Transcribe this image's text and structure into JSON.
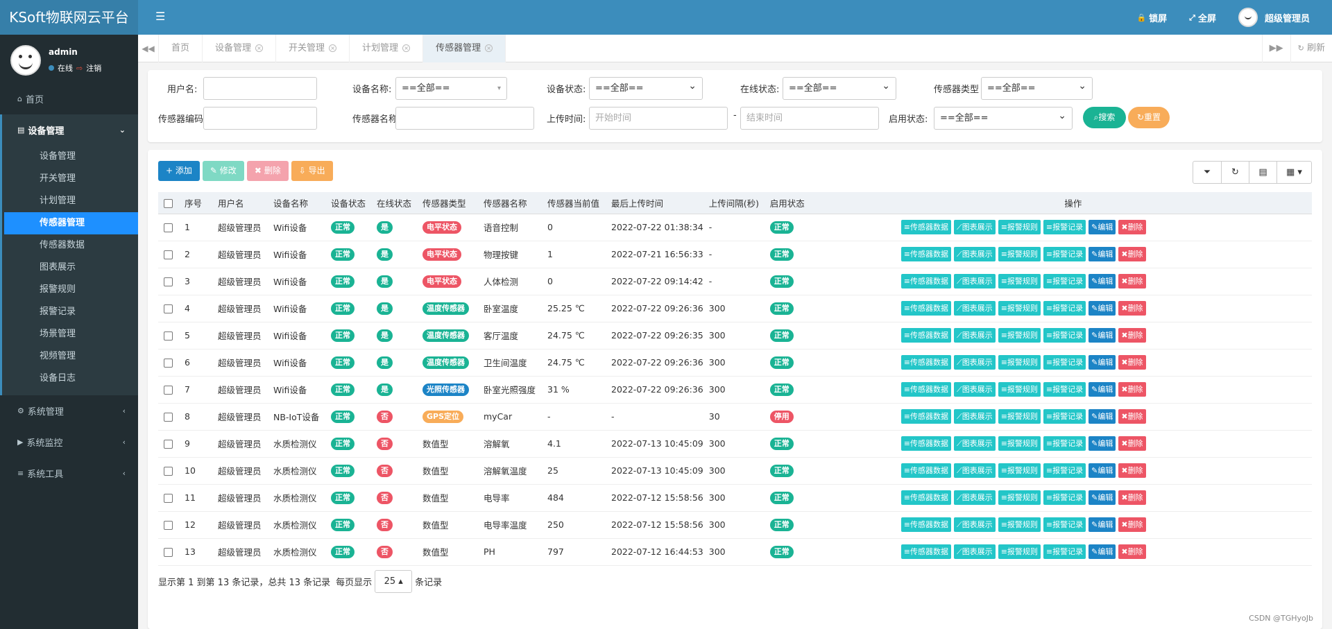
{
  "app": {
    "title": "KSoft物联网云平台"
  },
  "topbar": {
    "lock_label": "锁屏",
    "fullscreen_label": "全屏",
    "user_label": "超级管理员"
  },
  "user": {
    "name": "admin",
    "status": "在线",
    "logout": "注销"
  },
  "sidebar": {
    "home": "首页",
    "device_group": "设备管理",
    "device_items": [
      "设备管理",
      "开关管理",
      "计划管理",
      "传感器管理",
      "传感器数据",
      "图表展示",
      "报警规则",
      "报警记录",
      "场景管理",
      "视频管理",
      "设备日志"
    ],
    "active_item": "传感器管理",
    "system_manage": "系统管理",
    "system_monitor": "系统监控",
    "system_tools": "系统工具"
  },
  "tabs": [
    {
      "label": "首页",
      "closable": false
    },
    {
      "label": "设备管理",
      "closable": true
    },
    {
      "label": "开关管理",
      "closable": true
    },
    {
      "label": "计划管理",
      "closable": true
    },
    {
      "label": "传感器管理",
      "closable": true,
      "active": true
    }
  ],
  "tabs_refresh": "刷新",
  "search": {
    "username_label": "用户名:",
    "device_name_label": "设备名称:",
    "device_name_value": "==全部==",
    "device_status_label": "设备状态:",
    "device_status_value": "==全部==",
    "online_status_label": "在线状态:",
    "online_status_value": "==全部==",
    "sensor_type_label": "传感器类型",
    "sensor_type_value": "==全部==",
    "sensor_code_label": "传感器编码",
    "sensor_name_label": "传感器名称",
    "upload_time_label": "上传时间:",
    "start_placeholder": "开始时间",
    "dash": "-",
    "end_placeholder": "结束时间",
    "enable_status_label": "启用状态:",
    "enable_status_value": "==全部==",
    "search_btn": "搜索",
    "reset_btn": "重置"
  },
  "toolbar": {
    "add": "添加",
    "edit": "修改",
    "delete": "删除",
    "export": "导出"
  },
  "columns": [
    "序号",
    "用户名",
    "设备名称",
    "设备状态",
    "在线状态",
    "传感器类型",
    "传感器名称",
    "传感器当前值",
    "最后上传时间",
    "上传间隔(秒)",
    "启用状态",
    "操作"
  ],
  "row_actions": {
    "data": "传感器数据",
    "chart": "图表展示",
    "rule": "报警规则",
    "record": "报警记录",
    "edit": "编辑",
    "delete": "删除"
  },
  "rows": [
    {
      "no": "1",
      "user": "超级管理员",
      "device": "Wifi设备",
      "dstatus": "正常",
      "online": "是",
      "stype": "电平状态",
      "stype_style": "level",
      "sname": "语音控制",
      "value": "0",
      "time": "2022-07-22 01:38:34",
      "interval": "-",
      "enable": "正常"
    },
    {
      "no": "2",
      "user": "超级管理员",
      "device": "Wifi设备",
      "dstatus": "正常",
      "online": "是",
      "stype": "电平状态",
      "stype_style": "level",
      "sname": "物理按键",
      "value": "1",
      "time": "2022-07-21 16:56:33",
      "interval": "-",
      "enable": "正常"
    },
    {
      "no": "3",
      "user": "超级管理员",
      "device": "Wifi设备",
      "dstatus": "正常",
      "online": "是",
      "stype": "电平状态",
      "stype_style": "level",
      "sname": "人体检测",
      "value": "0",
      "time": "2022-07-22 09:14:42",
      "interval": "-",
      "enable": "正常"
    },
    {
      "no": "4",
      "user": "超级管理员",
      "device": "Wifi设备",
      "dstatus": "正常",
      "online": "是",
      "stype": "温度传感器",
      "stype_style": "temp",
      "sname": "卧室温度",
      "value": "25.25 ℃",
      "time": "2022-07-22 09:26:36",
      "interval": "300",
      "enable": "正常"
    },
    {
      "no": "5",
      "user": "超级管理员",
      "device": "Wifi设备",
      "dstatus": "正常",
      "online": "是",
      "stype": "温度传感器",
      "stype_style": "temp",
      "sname": "客厅温度",
      "value": "24.75 ℃",
      "time": "2022-07-22 09:26:35",
      "interval": "300",
      "enable": "正常"
    },
    {
      "no": "6",
      "user": "超级管理员",
      "device": "Wifi设备",
      "dstatus": "正常",
      "online": "是",
      "stype": "温度传感器",
      "stype_style": "temp",
      "sname": "卫生间温度",
      "value": "24.75 ℃",
      "time": "2022-07-22 09:26:36",
      "interval": "300",
      "enable": "正常"
    },
    {
      "no": "7",
      "user": "超级管理员",
      "device": "Wifi设备",
      "dstatus": "正常",
      "online": "是",
      "stype": "光照传感器",
      "stype_style": "light",
      "sname": "卧室光照强度",
      "value": "31 %",
      "time": "2022-07-22 09:26:36",
      "interval": "300",
      "enable": "正常"
    },
    {
      "no": "8",
      "user": "超级管理员",
      "device": "NB-IoT设备",
      "dstatus": "正常",
      "online": "否",
      "stype": "GPS定位",
      "stype_style": "gps",
      "sname": "myCar",
      "value": "-",
      "time": "-",
      "interval": "30",
      "enable": "停用"
    },
    {
      "no": "9",
      "user": "超级管理员",
      "device": "水质检测仪",
      "dstatus": "正常",
      "online": "否",
      "stype": "数值型",
      "stype_style": "plain",
      "sname": "溶解氧",
      "value": "4.1",
      "time": "2022-07-13 10:45:09",
      "interval": "300",
      "enable": "正常"
    },
    {
      "no": "10",
      "user": "超级管理员",
      "device": "水质检测仪",
      "dstatus": "正常",
      "online": "否",
      "stype": "数值型",
      "stype_style": "plain",
      "sname": "溶解氧温度",
      "value": "25",
      "time": "2022-07-13 10:45:09",
      "interval": "300",
      "enable": "正常"
    },
    {
      "no": "11",
      "user": "超级管理员",
      "device": "水质检测仪",
      "dstatus": "正常",
      "online": "否",
      "stype": "数值型",
      "stype_style": "plain",
      "sname": "电导率",
      "value": "484",
      "time": "2022-07-12 15:58:56",
      "interval": "300",
      "enable": "正常"
    },
    {
      "no": "12",
      "user": "超级管理员",
      "device": "水质检测仪",
      "dstatus": "正常",
      "online": "否",
      "stype": "数值型",
      "stype_style": "plain",
      "sname": "电导率温度",
      "value": "250",
      "time": "2022-07-12 15:58:56",
      "interval": "300",
      "enable": "正常"
    },
    {
      "no": "13",
      "user": "超级管理员",
      "device": "水质检测仪",
      "dstatus": "正常",
      "online": "否",
      "stype": "数值型",
      "stype_style": "plain",
      "sname": "PH",
      "value": "797",
      "time": "2022-07-12 16:44:53",
      "interval": "300",
      "enable": "正常"
    }
  ],
  "pager": {
    "summary": "显示第 1 到第 13 条记录，总共 13 条记录",
    "per_page_prefix": "每页显示",
    "page_size": "25",
    "per_page_suffix": "条记录"
  },
  "watermark": "CSDN @TGHyoJb",
  "colors": {
    "primary": "#3c8dbc",
    "sidebar": "#222d32",
    "active": "#1e90ff",
    "green": "#1ab394",
    "red": "#ed5565",
    "cyan": "#23c6c8",
    "blue": "#1c84c6",
    "orange": "#f8ac59"
  }
}
